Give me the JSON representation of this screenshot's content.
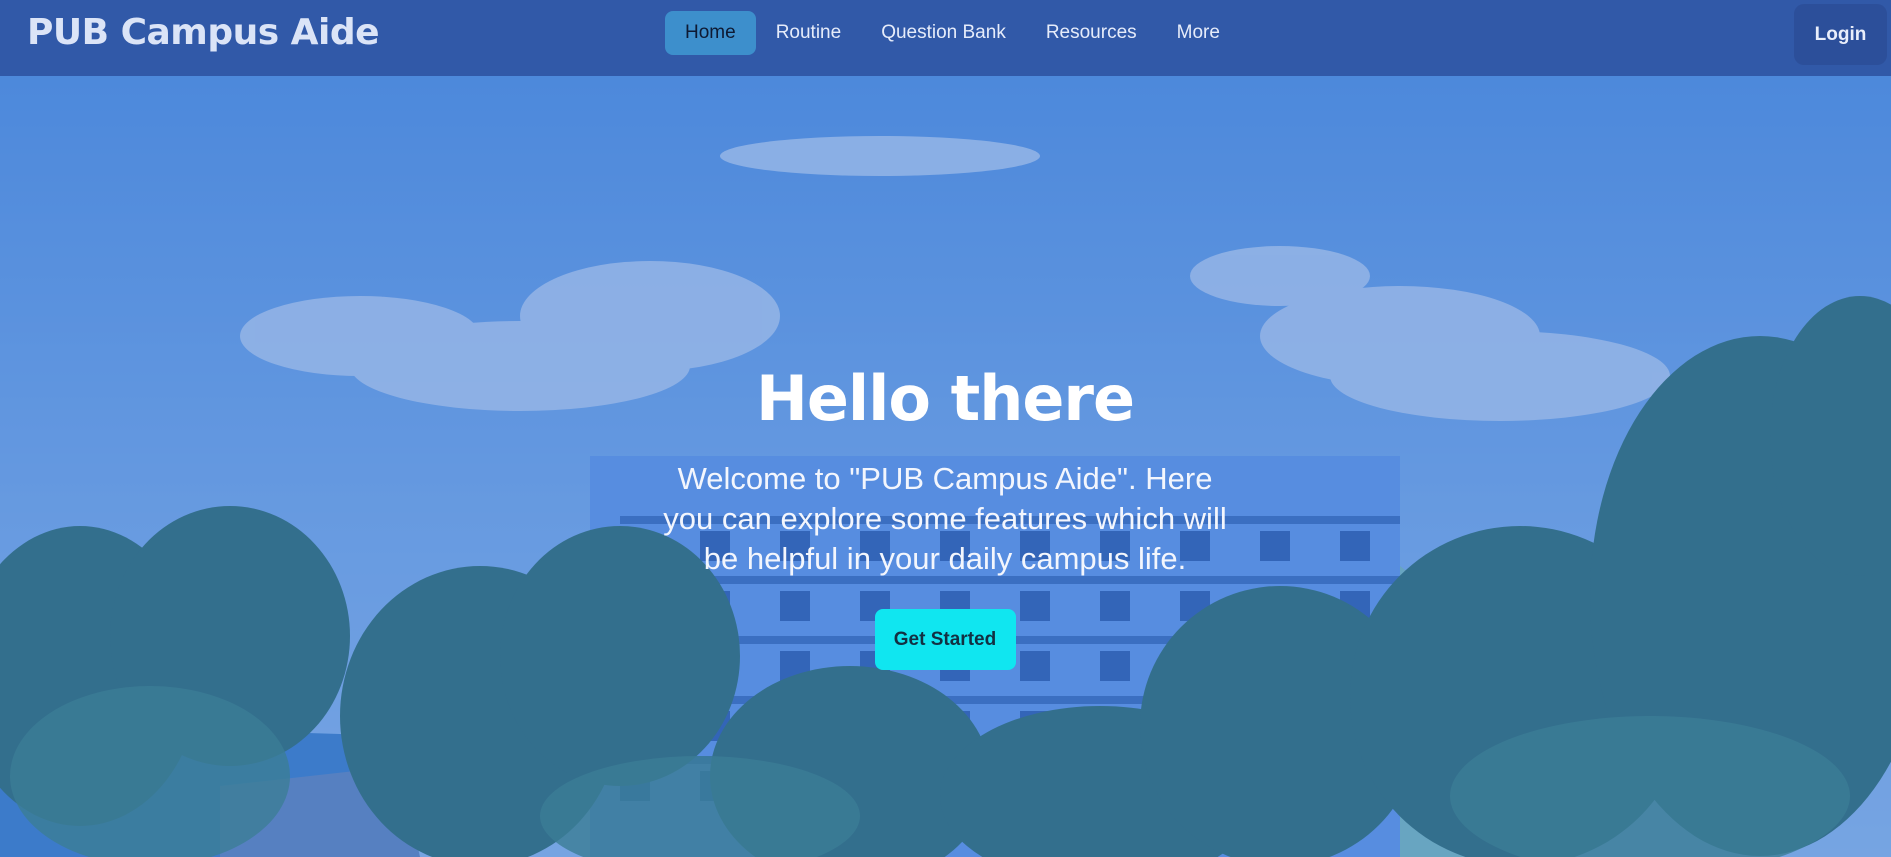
{
  "header": {
    "brand": "PUB Campus Aide",
    "nav": [
      {
        "label": "Home",
        "active": true
      },
      {
        "label": "Routine",
        "active": false
      },
      {
        "label": "Question Bank",
        "active": false
      },
      {
        "label": "Resources",
        "active": false
      },
      {
        "label": "More",
        "active": false
      }
    ],
    "login_label": "Login"
  },
  "hero": {
    "title": "Hello there",
    "text": "Welcome to \"PUB Campus Aide\". Here you can explore some features which will be helpful in your daily campus life.",
    "cta_label": "Get Started"
  },
  "colors": {
    "navbar": "#3159a8",
    "active_tab": "#3d8fcc",
    "cta": "#10e6f0",
    "overlay": "#3a6ecd"
  }
}
